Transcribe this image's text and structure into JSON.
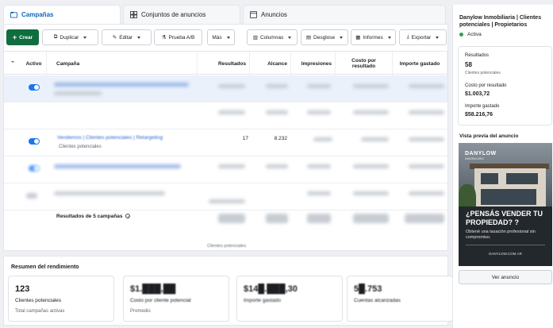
{
  "tabs": [
    {
      "label": "Campañas",
      "icon": "folder-icon"
    },
    {
      "label": "Conjuntos de anuncios",
      "icon": "grid-icon"
    },
    {
      "label": "Anuncios",
      "icon": "ad-icon"
    }
  ],
  "toolbar": {
    "create": "Crear",
    "duplicate": "Duplicar",
    "edit": "Editar",
    "ab_test": "Prueba A/B",
    "more": "Más",
    "columns": "Columnas",
    "breakdown": "Desglose",
    "reports": "Informes",
    "export": "Exportar"
  },
  "table": {
    "headers": {
      "active": "Activo",
      "campaign": "Campaña",
      "results": "Resultados",
      "reach": "Alcance",
      "impressions": "Impresiones",
      "cpr": "Costo por resultado",
      "spent": "Importe gastado"
    },
    "visible_row": {
      "name": "Vendemos | Clientes potenciales | Retargeting",
      "sub": "Clientes potenciales",
      "results": "17",
      "reach": "8.232"
    },
    "totals_label": "Resultados de 5 campañas",
    "totals_sub": "Clientes potenciales"
  },
  "summary": {
    "title": "Resumen del rendimiento",
    "cards": [
      {
        "value": "123",
        "label": "Clientes potenciales",
        "sub": "Total campañas activas"
      },
      {
        "value": "$1.███,██",
        "label": "Costo por cliente potencial",
        "sub": "Promedio"
      },
      {
        "value": "$14█.███,30",
        "label": "Importe gastado",
        "sub": ""
      },
      {
        "value": "5█.753",
        "label": "Cuentas alcanzadas",
        "sub": ""
      }
    ]
  },
  "panel": {
    "title": "Danylow Inmobiliaria | Clientes potenciales | Propietarios",
    "status": "Activa",
    "results_label": "Resultados",
    "results_value": "58",
    "results_sub": "Clientes potenciales",
    "cpr_label": "Costo por resultado",
    "cpr_value": "$1.003,72",
    "spent_label": "Importe gastado",
    "spent_value": "$58.216,76",
    "preview_label": "Vista previa del anuncio",
    "view_button": "Ver anuncio"
  },
  "ad": {
    "brand": "DANYLOW",
    "brand_sub": "INMOBILIARIA",
    "headline": "¿PENSÁS VENDER TU PROPIEDAD? ?",
    "body": "Obtené una tasación profesional sin compromiso.",
    "url": "DANYLOW.COM.AR"
  },
  "colors": {
    "accent": "#1877f2",
    "create_button": "#0e6e3f",
    "status_active": "#31a24c"
  }
}
